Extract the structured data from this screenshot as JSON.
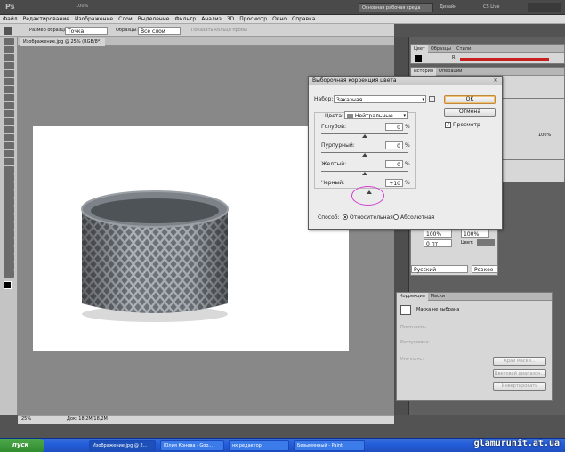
{
  "app": {
    "logo": "Ps",
    "workspace_button": "Основная рабочая среда",
    "design_button": "Дизайн",
    "cslive": "CS Live"
  },
  "menu": [
    "Файл",
    "Редактирование",
    "Изображение",
    "Слои",
    "Выделение",
    "Фильтр",
    "Анализ",
    "3D",
    "Просмотр",
    "Окно",
    "Справка"
  ],
  "options": {
    "sample_size_label": "Размер образца:",
    "sample_size_value": "Точка",
    "samples_label": "Образцы:",
    "samples_value": "Все слои",
    "ring_label": "Показать кольцо пробы"
  },
  "doc_tab": "Изображение.jpg @ 25% (RGB/8*)",
  "zoom_top": "100%",
  "status": {
    "zoom": "25%",
    "doc": "Док: 18,2M/18,2M"
  },
  "dialog": {
    "title": "Выборочная коррекция цвета",
    "preset_label": "Набор:",
    "preset_value": "Заказная",
    "colors_label": "Цвета:",
    "colors_value": "Нейтральные",
    "sliders": [
      {
        "label": "Голубой:",
        "value": "0",
        "unit": "%"
      },
      {
        "label": "Пурпурный:",
        "value": "0",
        "unit": "%"
      },
      {
        "label": "Желтый:",
        "value": "0",
        "unit": "%"
      },
      {
        "label": "Черный:",
        "value": "+10",
        "unit": "%"
      }
    ],
    "slider_levels": [
      0,
      0,
      0,
      10
    ],
    "method_label": "Способ:",
    "relative": "Относительная",
    "absolute": "Абсолютная",
    "ok": "OK",
    "cancel": "Отмена",
    "preview": "Просмотр"
  },
  "panels": {
    "color_tabs": [
      "Цвет",
      "Образцы",
      "Стили"
    ],
    "color_row": "R",
    "history_tabs": [
      "История",
      "Операции"
    ],
    "char_values": {
      "size": "100%",
      "size2": "100%",
      "track": "0 пт",
      "color_label": "Цвет:",
      "lang": "Русский",
      "aa": "Резкое",
      "pct": "100%"
    },
    "masks_tabs": [
      "Коррекция",
      "Маски"
    ],
    "masks_label": "Маска не выбрана",
    "masks_buttons": [
      "Край маски...",
      "Цветовой диапазон...",
      "Инвертировать"
    ],
    "masks_fields": [
      "Плотность:",
      "Растушевка:",
      "Уточнить:"
    ]
  },
  "taskbar": {
    "start": "пуск",
    "items": [
      "Изображение.jpg @ 2...",
      "Юлия Конева - Goo...",
      "нк редактор",
      "Безымянный - Paint"
    ]
  },
  "watermark": "glamurunit.at.ua",
  "colors": {
    "accent_red": "#c62020",
    "dialog_bg": "#ececec",
    "annotation": "#d03cd0"
  }
}
